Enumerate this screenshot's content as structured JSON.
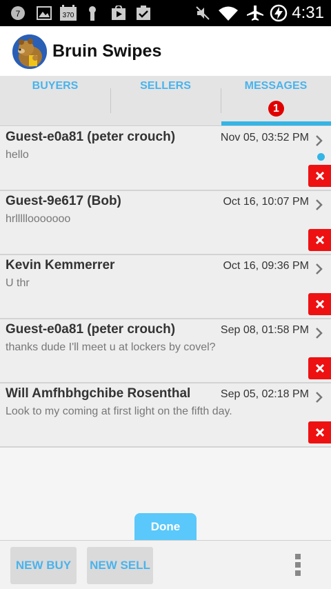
{
  "status_bar": {
    "time": "4:31",
    "notification_badge": "7",
    "count_badge": "370",
    "battery_level": "charging"
  },
  "app": {
    "title": "Bruin Swipes"
  },
  "tabs": [
    {
      "label": "BUYERS",
      "active": false
    },
    {
      "label": "SELLERS",
      "active": false
    },
    {
      "label": "MESSAGES",
      "active": true,
      "badge": "1"
    }
  ],
  "messages": [
    {
      "name": "Guest-e0a81 (peter crouch)",
      "time": "Nov 05, 03:52 PM",
      "text": "hello",
      "unread": true
    },
    {
      "name": "Guest-9e617 (Bob)",
      "time": "Oct 16, 10:07 PM",
      "text": "hrlllllooooooo",
      "unread": false
    },
    {
      "name": "Kevin Kemmerrer",
      "time": "Oct 16, 09:36 PM",
      "text": "U thr",
      "unread": false
    },
    {
      "name": "Guest-e0a81 (peter crouch)",
      "time": "Sep 08, 01:58 PM",
      "text": "thanks dude I'll meet u at lockers by covel?",
      "unread": false
    },
    {
      "name": "Will Amfhbhgchibe Rosenthal",
      "time": "Sep 05, 02:18 PM",
      "text": "Look to my coming at first light on the fifth day.",
      "unread": false
    }
  ],
  "done_label": "Done",
  "bottom_bar": {
    "new_buy_label": "NEW BUY",
    "new_sell_label": "NEW SELL"
  },
  "colors": {
    "accent": "#33b5e5",
    "tab_text": "#4ab3ec",
    "delete": "#ee1111",
    "badge": "#e00000"
  },
  "icons": {
    "chevron": "chevron-right-icon",
    "delete": "close-icon",
    "overflow": "overflow-menu-icon"
  }
}
